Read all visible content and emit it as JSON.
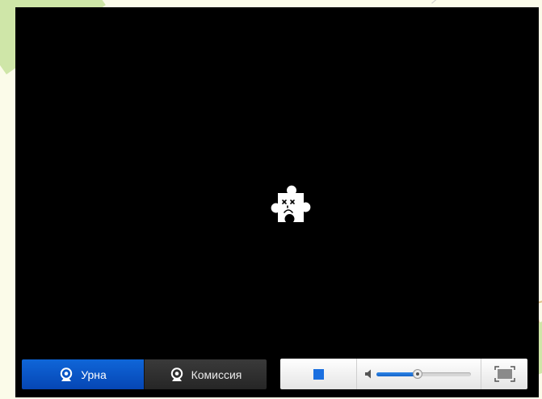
{
  "camera_switch": {
    "tabs": [
      {
        "label": "Урна",
        "active": true
      },
      {
        "label": "Комиссия",
        "active": false
      }
    ]
  },
  "controls": {
    "volume_level": 0.44
  },
  "icons": {
    "error": "sad-puzzle-icon",
    "camera": "webcam-icon",
    "stop": "stop-icon",
    "volume": "speaker-icon",
    "fullscreen": "fullscreen-icon"
  },
  "colors": {
    "active_tab": "#0b55c6",
    "inactive_tab": "#2e2e2e",
    "accent": "#1a6fe0",
    "video_bg": "#000000"
  }
}
